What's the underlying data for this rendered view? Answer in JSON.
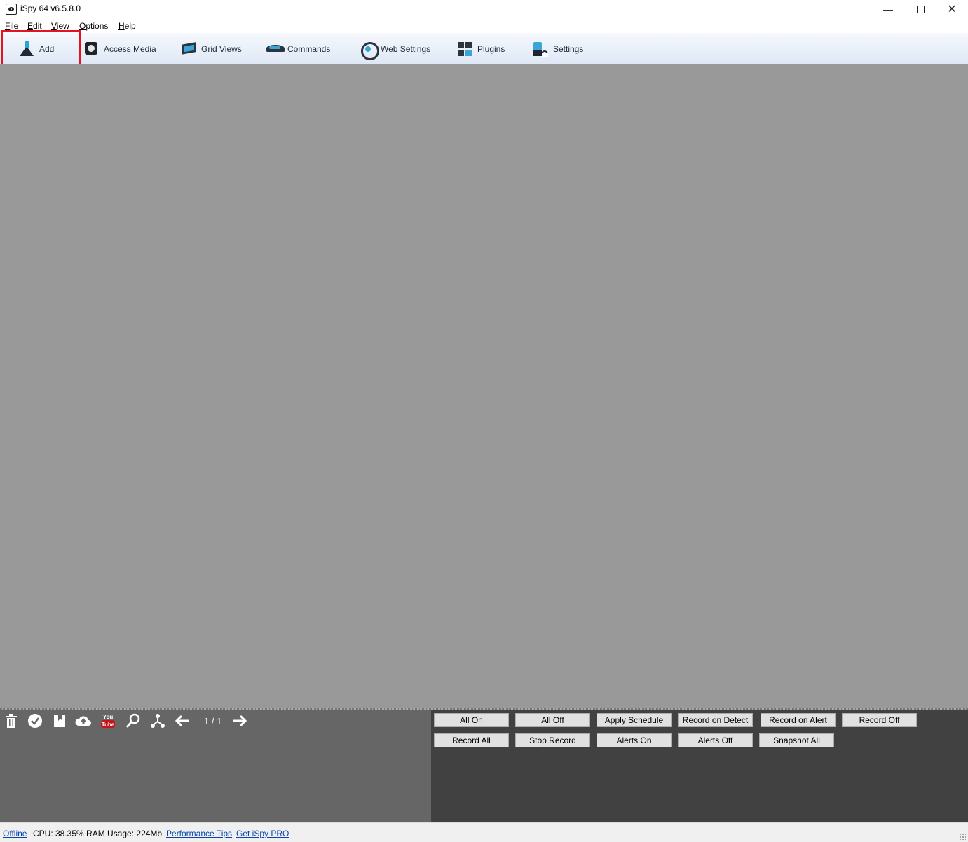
{
  "window": {
    "title": "iSpy 64 v6.5.8.0",
    "minimize_glyph": "—",
    "close_glyph": "✕"
  },
  "menu": [
    {
      "label": "File",
      "mnemonic": "F",
      "rest": "ile"
    },
    {
      "label": "Edit",
      "mnemonic": "E",
      "rest": "dit"
    },
    {
      "label": "View",
      "mnemonic": "V",
      "rest": "iew"
    },
    {
      "label": "Options",
      "mnemonic": "O",
      "rest": "ptions"
    },
    {
      "label": "Help",
      "mnemonic": "H",
      "rest": "elp"
    }
  ],
  "toolbar": {
    "add": "Add",
    "access_media": "Access Media",
    "grid_views": "Grid Views",
    "commands": "Commands",
    "web_settings": "Web Settings",
    "plugins": "Plugins",
    "settings": "Settings"
  },
  "bottom_toolbar": {
    "page_indicator": "1 / 1",
    "icons": [
      "trash-icon",
      "check-icon",
      "bookmark-icon",
      "upload-cloud-icon",
      "youtube-icon",
      "search-icon",
      "share-icon",
      "arrow-left-icon",
      "arrow-right-icon"
    ],
    "youtube_top": "You",
    "youtube_bottom": "Tube"
  },
  "commands": {
    "row1": [
      "All On",
      "All Off",
      "Apply Schedule",
      "Record on Detect",
      "Record on Alert",
      "Record Off"
    ],
    "row2": [
      "Record All",
      "Stop Record",
      "Alerts On",
      "Alerts Off",
      "Snapshot All"
    ]
  },
  "status": {
    "offline": "Offline",
    "cpu_ram": "CPU: 38.35% RAM Usage: 224Mb",
    "performance_tips": "Performance Tips",
    "get_pro": "Get iSpy PRO"
  },
  "colors": {
    "highlight": "#e3141f",
    "workspace": "#999999",
    "bottom_left": "#666666",
    "bottom_right": "#414141",
    "accent": "#3aa6d8"
  }
}
